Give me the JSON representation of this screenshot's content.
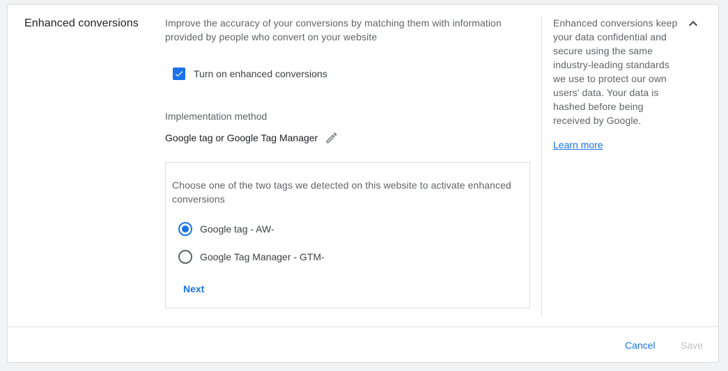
{
  "section": {
    "title": "Enhanced conversions",
    "description": "Improve the accuracy of your conversions by matching them with information provided by people who convert on your website"
  },
  "checkbox": {
    "label": "Turn on enhanced conversions",
    "checked": true
  },
  "implementation": {
    "label": "Implementation method",
    "value": "Google tag or Google Tag Manager"
  },
  "tag_choice": {
    "prompt": "Choose one of the two tags we detected on this website to activate enhanced conversions",
    "options": [
      {
        "label": "Google tag - AW-",
        "selected": true
      },
      {
        "label": "Google Tag Manager - GTM-",
        "selected": false
      }
    ],
    "next_label": "Next"
  },
  "help": {
    "text": "Enhanced conversions keep your data confidential and secure using the same industry-leading standards we use to protect our own users' data. Your data is hashed before being received by Google.",
    "link_label": "Learn more"
  },
  "footer": {
    "cancel_label": "Cancel",
    "save_label": "Save"
  },
  "colors": {
    "accent": "#1a73e8",
    "disabled": "#bdc1c6",
    "divider": "#dadce0"
  },
  "icons": {
    "edit": "pencil-icon",
    "collapse": "chevron-up-icon",
    "check": "check-icon"
  }
}
